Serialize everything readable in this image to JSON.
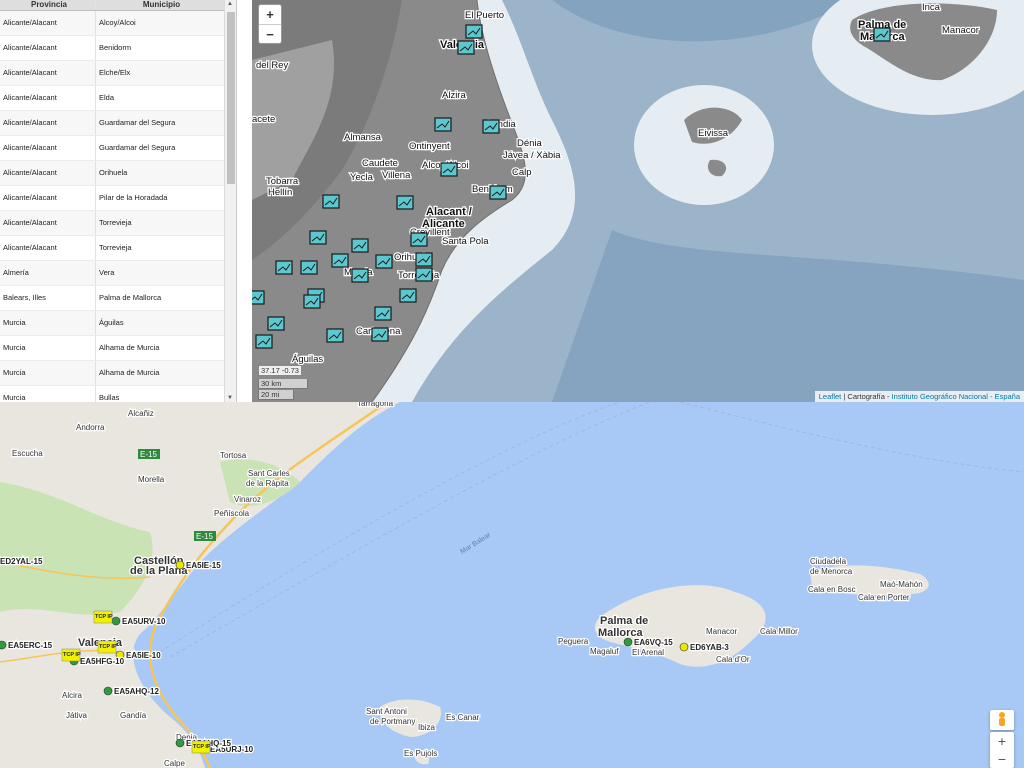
{
  "table": {
    "headers": [
      "Provincia",
      "Municipio"
    ],
    "rows": [
      [
        "Alicante/Alacant",
        "Alcoy/Alcoi"
      ],
      [
        "Alicante/Alacant",
        "Benidorm"
      ],
      [
        "Alicante/Alacant",
        "Elche/Elx"
      ],
      [
        "Alicante/Alacant",
        "Elda"
      ],
      [
        "Alicante/Alacant",
        "Guardamar del Segura"
      ],
      [
        "Alicante/Alacant",
        "Guardamar del Segura"
      ],
      [
        "Alicante/Alacant",
        "Orihuela"
      ],
      [
        "Alicante/Alacant",
        "Pilar de la Horadada"
      ],
      [
        "Alicante/Alacant",
        "Torrevieja"
      ],
      [
        "Alicante/Alacant",
        "Torrevieja"
      ],
      [
        "Almería",
        "Vera"
      ],
      [
        "Balears, Illes",
        "Palma de Mallorca"
      ],
      [
        "Murcia",
        "Águilas"
      ],
      [
        "Murcia",
        "Alhama de Murcia"
      ],
      [
        "Murcia",
        "Alhama de Murcia"
      ],
      [
        "Murcia",
        "Bullas"
      ]
    ]
  },
  "map_top": {
    "zoom_in": "+",
    "zoom_out": "−",
    "coords": "37.17   -0.73",
    "scale_km": "30 km",
    "scale_mi": "20 mi",
    "attribution_leaflet": "Leaflet",
    "attribution_sep": " | Cartografía - ",
    "attribution_ign": "Instituto Geográfico Nacional - España",
    "colors": {
      "land": "#8a8a8a",
      "sea": "#9bb4c9",
      "shelf": "#e7eef3",
      "marker": "#5cc7cf"
    },
    "labels": [
      "El Puerto",
      "Valencia",
      "del Rey",
      "Alzira",
      "acete",
      "Gandia",
      "Almansa",
      "Dénia",
      "Ontinyent",
      "Jávea / Xàbia",
      "Caudete",
      "Alcoy/Alcoi",
      "Calp",
      "Yecla",
      "Villena",
      "Tobarra",
      "Hellín",
      "Benidorm",
      "Alacant /",
      "Alicante",
      "Crevillent",
      "Santa Pola",
      "Orihuela",
      "Murcia",
      "Torrevieja",
      "Cartagena",
      "Águilas",
      "Palma de",
      "Mallorca",
      "Inca",
      "Manacor",
      "Eivissa"
    ]
  },
  "map_bottom": {
    "zoom_in": "+",
    "zoom_out": "−",
    "colors": {
      "land": "#e9e6df",
      "sea": "#a8c9f5",
      "green": "#c9e3b5",
      "road": "#f5c55a"
    },
    "labels": [
      "Tarragona",
      "Alcañiz",
      "Andorra",
      "Escucha",
      "Tortosa",
      "Sant Carles",
      "de la Ràpita",
      "Morella",
      "Vinaroz",
      "Peñíscola",
      "Castellón",
      "de la Plana",
      "Valencia",
      "Alcira",
      "Játiva",
      "Gandía",
      "Denia",
      "Calpe",
      "Mar Balear",
      "Ciudadela",
      "de Menorca",
      "Maó-Mahón",
      "Cala en Bosc",
      "Cala en Porter",
      "Palma de",
      "Mallorca",
      "Manacor",
      "Cala Millor",
      "Peguera",
      "Magaluf",
      "El Arenal",
      "Cala d'Or",
      "Sant Antoni",
      "de Portmany",
      "Es Canar",
      "Ibiza",
      "Es Pujols",
      "E-15",
      "E-15"
    ],
    "station_labels": [
      "ED2YAL-15",
      "EA5IE-15",
      "EA5URV-10",
      "EA5ERC-15",
      "EA5IE-10",
      "EA5HFG-10",
      "EA5AHQ-12",
      "EA5URJ-10",
      "EA5AHQ-15",
      "EA6VQ-15",
      "ED6YAB-3"
    ],
    "tcp_tag": "TCP IP"
  }
}
